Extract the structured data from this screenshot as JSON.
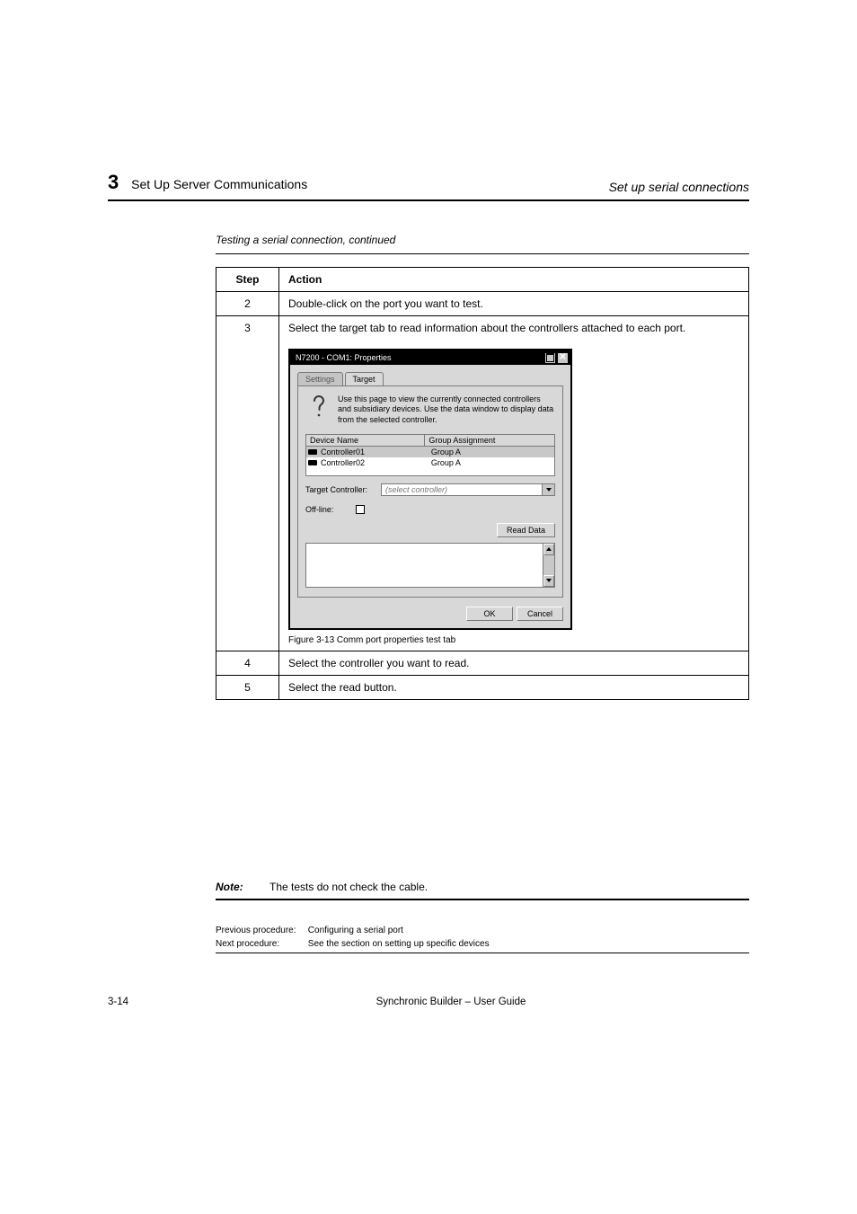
{
  "header": {
    "left_num": "3",
    "left_text": "Set Up Server Communications",
    "right": "Set up serial connections"
  },
  "caption_continued": "Testing a serial connection, continued",
  "table": {
    "h_step": "Step",
    "h_action": "Action",
    "row1": {
      "step": "2",
      "action": "Double-click on the port you want to test."
    },
    "row2": {
      "step": "4",
      "action": "Select the  controller you want to read."
    },
    "row3": {
      "step": "5",
      "action": "Select the read button."
    },
    "step3": {
      "num": "3",
      "lead": "Select the target tab to read information about the controllers attached to each port.",
      "figure_caption": "Figure 3-13 Comm port properties test tab"
    }
  },
  "dialog": {
    "title": "N7200 - COM1: Properties",
    "tabs": {
      "settings": "Settings",
      "target": "Target"
    },
    "wiz_text": "Use this page to view the currently connected controllers and subsidiary devices. Use the data window to display data from the selected controller.",
    "col1": "Device Name",
    "col2": "Group Assignment",
    "dev1": {
      "name": "Controller01",
      "grp": "Group A"
    },
    "dev2": {
      "name": "Controller02",
      "grp": "Group A"
    },
    "label_target": "Target Controller:",
    "target_placeholder": "(select controller)",
    "label_offline": "Off-line:",
    "btn_read": "Read Data",
    "btn_ok": "OK",
    "btn_cancel": "Cancel"
  },
  "note": {
    "label": "Note:",
    "text": "The tests do not check the cable."
  },
  "prevnext": {
    "prev_k": "Previous procedure:",
    "prev_v": "Configuring a serial port",
    "next_k": "Next procedure:",
    "next_v": "See the section on setting up specific devices"
  },
  "footer": {
    "page": "3-14",
    "mid": "Synchronic Builder – User Guide"
  }
}
